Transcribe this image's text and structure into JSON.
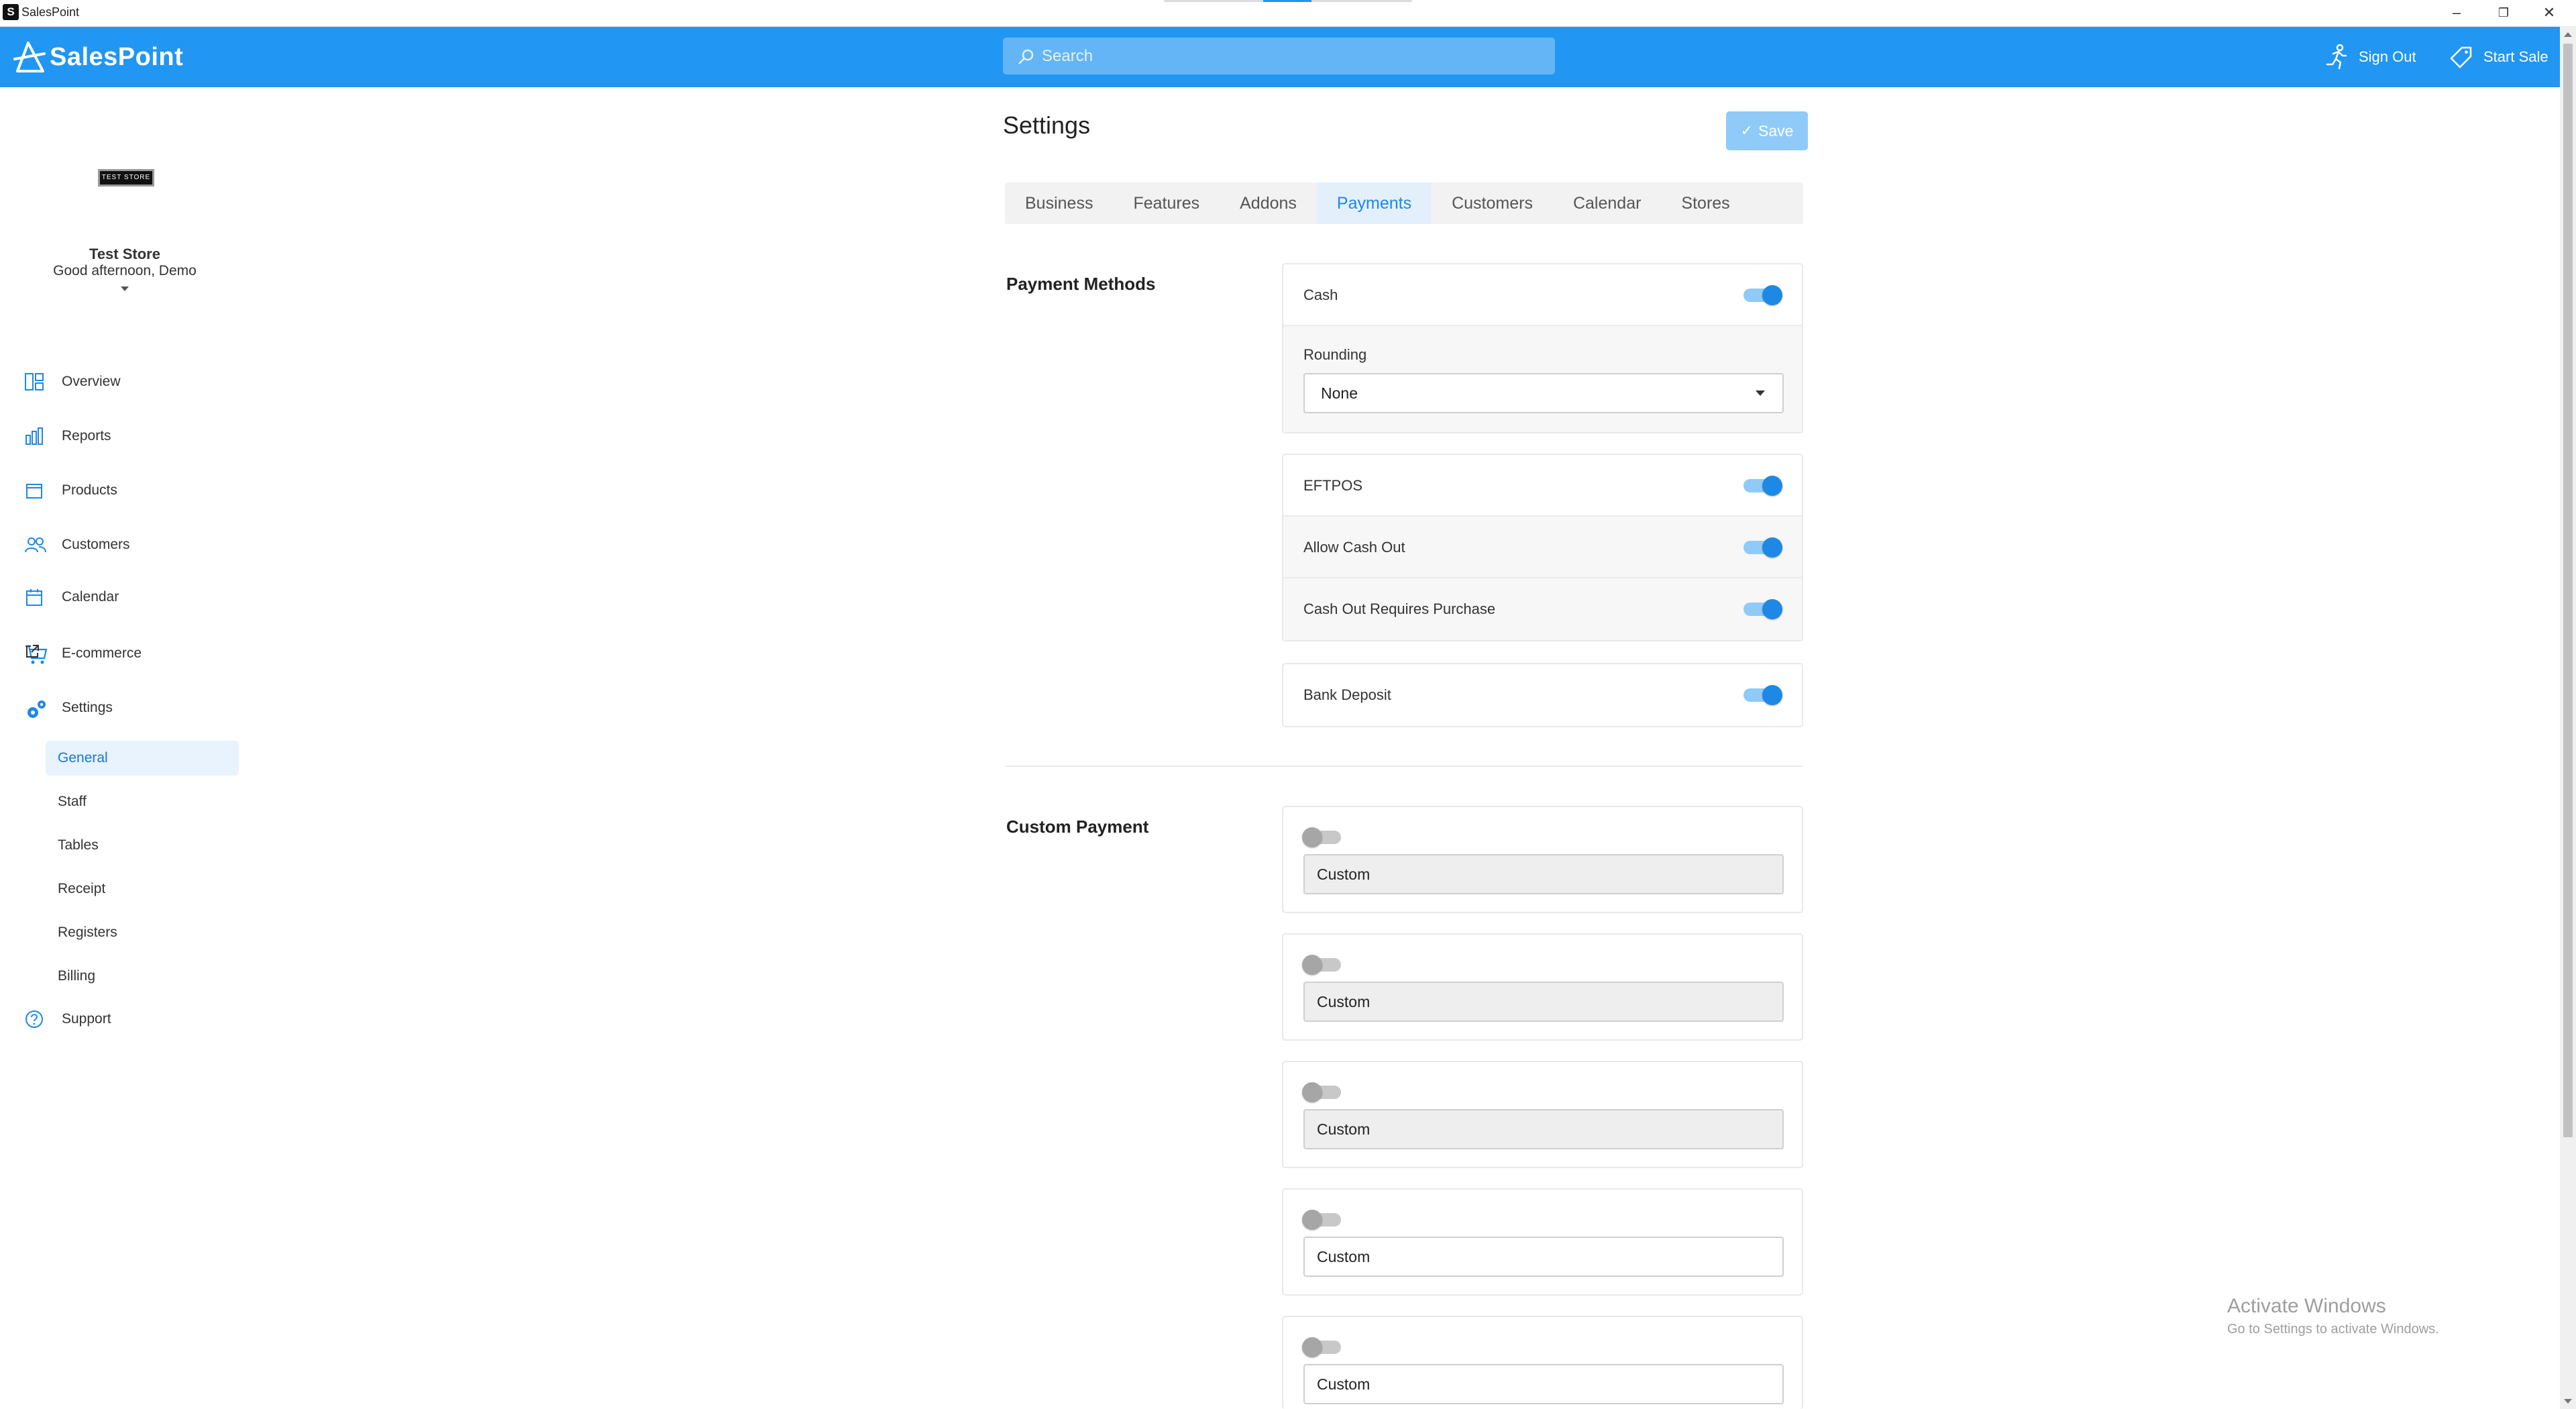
{
  "window": {
    "title": "SalesPoint",
    "minimize": "–",
    "restore": "❐",
    "close": "✕"
  },
  "header": {
    "brand": "SalesPoint",
    "search_placeholder": "Search",
    "sign_out": "Sign Out",
    "start_sale": "Start Sale"
  },
  "sidebar": {
    "store_logo_text": "TEST STORE",
    "store_name": "Test Store",
    "greeting": "Good afternoon, Demo",
    "nav": {
      "overview": "Overview",
      "reports": "Reports",
      "products": "Products",
      "customers": "Customers",
      "calendar": "Calendar",
      "ecommerce": "E-commerce",
      "settings": "Settings",
      "support": "Support"
    },
    "settings_sub": [
      "General",
      "Staff",
      "Tables",
      "Receipt",
      "Registers",
      "Billing"
    ]
  },
  "main": {
    "title": "Settings",
    "save_label": "Save",
    "tabs": [
      "Business",
      "Features",
      "Addons",
      "Payments",
      "Customers",
      "Calendar",
      "Stores"
    ],
    "active_tab": "Payments",
    "payment_methods": {
      "title": "Payment Methods",
      "cash": {
        "label": "Cash",
        "enabled": true
      },
      "rounding": {
        "label": "Rounding",
        "value": "None"
      },
      "eftpos": {
        "label": "EFTPOS",
        "enabled": true
      },
      "allow_cash_out": {
        "label": "Allow Cash Out",
        "enabled": true
      },
      "cash_out_requires_purchase": {
        "label": "Cash Out Requires Purchase",
        "enabled": true
      },
      "bank_deposit": {
        "label": "Bank Deposit",
        "enabled": true
      }
    },
    "custom_payment": {
      "title": "Custom Payment",
      "items": [
        {
          "value": "Custom",
          "enabled": false
        },
        {
          "value": "Custom",
          "enabled": false
        },
        {
          "value": "Custom",
          "enabled": false
        },
        {
          "value": "Custom",
          "enabled": false
        },
        {
          "value": "Custom",
          "enabled": false
        }
      ]
    }
  },
  "watermark": {
    "line1": "Activate Windows",
    "line2": "Go to Settings to activate Windows."
  },
  "colors": {
    "primary": "#2196f3",
    "accent": "#1e88e5",
    "search_bg": "#64b5f6"
  }
}
